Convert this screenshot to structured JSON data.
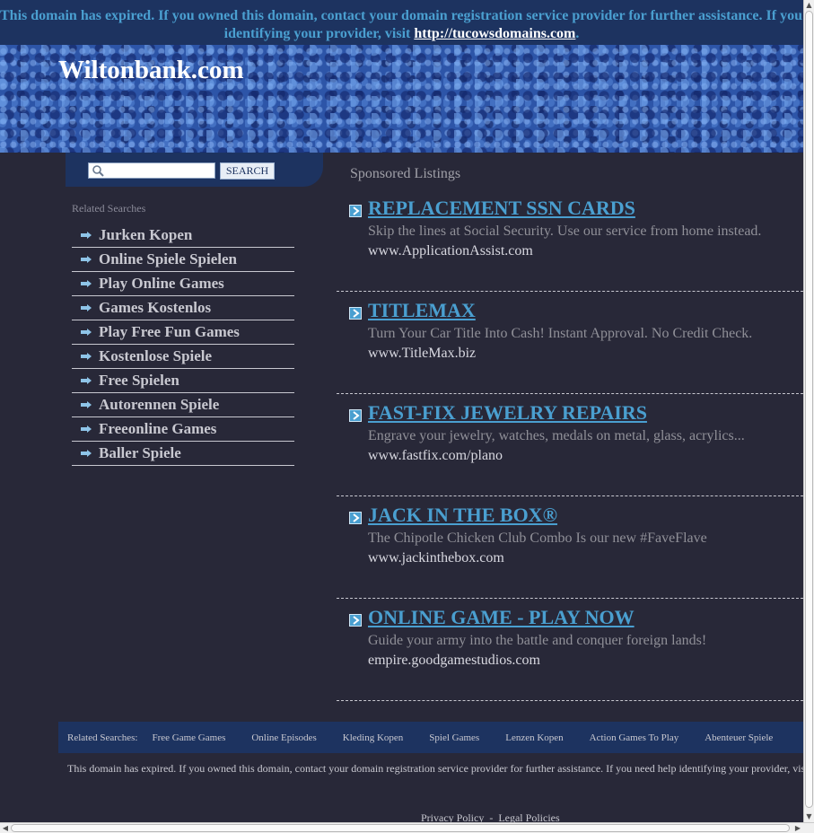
{
  "banner": {
    "line1": "This domain has expired. If you owned this domain, contact your domain registration service provider for further assistance. If you need help",
    "line2_prefix": "identifying your provider, visit ",
    "link": "http://tucowsdomains.com",
    "line2_suffix": "."
  },
  "header": {
    "title": "Wiltonbank.com"
  },
  "search": {
    "button_label": "SEARCH",
    "value": ""
  },
  "related": {
    "heading": "Related Searches",
    "items": [
      "Jurken Kopen",
      "Online Spiele Spielen",
      "Play Online Games",
      "Games Kostenlos",
      "Play Free Fun Games",
      "Kostenlose Spiele",
      "Free Spielen",
      "Autorennen Spiele",
      "Freeonline Games",
      "Baller Spiele"
    ]
  },
  "sponsored": {
    "heading": "Sponsored Listings",
    "listings": [
      {
        "title": "REPLACEMENT SSN CARDS",
        "desc": "Skip the lines at Social Security. Use our service from home instead.",
        "url": "www.ApplicationAssist.com"
      },
      {
        "title": "TITLEMAX",
        "desc": "Turn Your Car Title Into Cash! Instant Approval. No Credit Check.",
        "url": "www.TitleMax.biz"
      },
      {
        "title": "FAST-FIX JEWELRY REPAIRS",
        "desc": "Engrave your jewelry, watches, medals on metal, glass, acrylics...",
        "url": "www.fastfix.com/plano"
      },
      {
        "title": "JACK IN THE BOX®",
        "desc": "The Chipotle Chicken Club Combo Is our new #FaveFlave",
        "url": "www.jackinthebox.com"
      },
      {
        "title": "ONLINE GAME - PLAY NOW",
        "desc": "Guide your army into the battle and conquer foreign lands!",
        "url": "empire.goodgamestudios.com"
      }
    ]
  },
  "footer": {
    "related_label": "Related Searches:",
    "related_items": [
      "Free Game Games",
      "Online Episodes",
      "Kleding Kopen",
      "Spiel Games",
      "Lenzen Kopen",
      "Action Games To Play",
      "Abenteuer Spiele"
    ],
    "note": "This domain has expired. If you owned this domain, contact your domain registration service provider for further assistance. If you need help identifying your provider, visit http://tucowsdomains.com",
    "privacy": "Privacy Policy",
    "legal": "Legal Policies",
    "separator": "-"
  },
  "colors": {
    "background": "#282838",
    "banner": "#1d3360",
    "link": "#4a9fd0",
    "header": "#2d55a8"
  },
  "icons": {
    "search": "magnifier-icon",
    "list_bullet": "arrow-bullet-icon",
    "listing_bullet": "chevron-box-icon"
  }
}
